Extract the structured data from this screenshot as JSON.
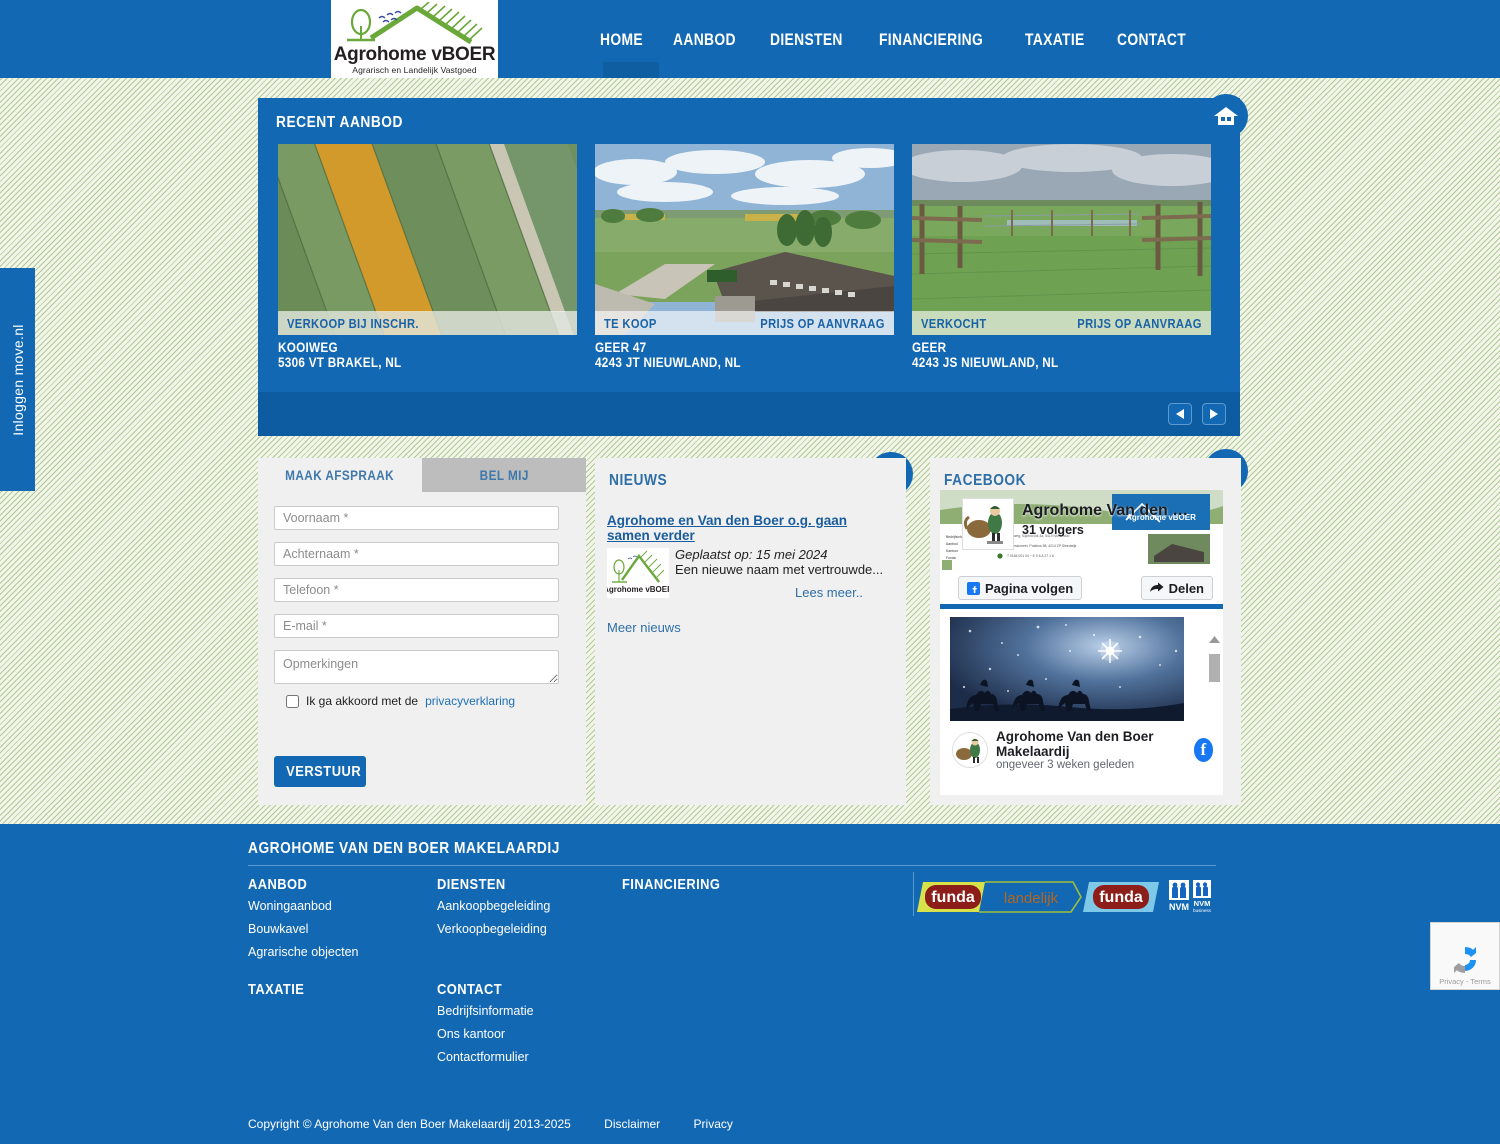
{
  "header": {
    "logo": {
      "name_primary": "Agrohome ",
      "name_secondary": "vBOER",
      "tagline": "Agrarisch en Landelijk Vastgoed"
    },
    "nav": [
      {
        "label": "HOME"
      },
      {
        "label": "AANBOD"
      },
      {
        "label": "DIENSTEN"
      },
      {
        "label": "FINANCIERING"
      },
      {
        "label": "TAXATIE"
      },
      {
        "label": "CONTACT"
      }
    ]
  },
  "left_tab": {
    "label": "Inloggen move.nl"
  },
  "carousel": {
    "heading": "RECENT AANBOD",
    "prev_label": "◀",
    "next_label": "▶",
    "items": [
      {
        "status": "VERKOOP BIJ INSCHR.",
        "price": "",
        "street": "KOOIWEG",
        "city": "5306 VT BRAKEL, NL"
      },
      {
        "status": "TE KOOP",
        "price": "PRIJS OP AANVRAAG",
        "street": "GEER 47",
        "city": "4243 JT NIEUWLAND, NL"
      },
      {
        "status": "VERKOCHT",
        "price": "PRIJS OP AANVRAAG",
        "street": "GEER",
        "city": "4243 JS NIEUWLAND, NL"
      }
    ]
  },
  "form": {
    "tab_active": "MAAK AFSPRAAK",
    "tab_inactive": "BEL MIJ",
    "fields": [
      {
        "placeholder": "Voornaam *",
        "value": ""
      },
      {
        "placeholder": "Achternaam *",
        "value": ""
      },
      {
        "placeholder": "Telefoon *",
        "value": ""
      },
      {
        "placeholder": "E-mail *",
        "value": ""
      }
    ],
    "textarea_placeholder": "Opmerkingen",
    "consent_text": "Ik ga akkoord met de ",
    "consent_link": "privacyverklaring",
    "submit_label": "VERSTUUR"
  },
  "news": {
    "heading": "NIEUWS",
    "item_title": "Agrohome en Van den Boer o.g. gaan samen verder",
    "item_date": "Geplaatst op: 15 mei 2024",
    "item_excerpt": "Een nieuwe naam met vertrouwde...",
    "read_more": "Lees meer..",
    "more_news": "Meer nieuws"
  },
  "facebook": {
    "heading": "FACEBOOK",
    "page_name": "Agrohome Van den …",
    "followers": "31 volgers",
    "follow_label": "Pagina volgen",
    "share_label": "Delen",
    "post_author": "Agrohome Van den Boer Makelaardij",
    "post_time": "ongeveer 3 weken geleden"
  },
  "footer": {
    "brand": "AGROHOME VAN DEN BOER MAKELAARDIJ",
    "columns": [
      {
        "title": "AANBOD",
        "links": [
          "Woningaanbod",
          "Bouwkavel",
          "Agrarische objecten"
        ]
      },
      {
        "title": "DIENSTEN",
        "links": [
          "Aankoopbegeleiding",
          "Verkoopbegeleiding"
        ]
      },
      {
        "title": "FINANCIERING",
        "links": []
      },
      {
        "title": "TAXATIE",
        "links": []
      },
      {
        "title": "CONTACT",
        "links": [
          "Bedrijfsinformatie",
          "Ons kantoor",
          "Contactformulier"
        ]
      }
    ],
    "partners": [
      {
        "name": "funda landelijk"
      },
      {
        "name": "funda"
      },
      {
        "name": "NVM"
      },
      {
        "name": "NVM business"
      }
    ],
    "copyright": "Copyright © Agrohome Van den Boer Makelaardij 2013-2025",
    "disclaimer": "Disclaimer",
    "privacy": "Privacy"
  },
  "recaptcha": {
    "text": "Privacy - Terms"
  },
  "colors": {
    "brand_blue": "#1268b3",
    "dark_blue": "#0d5ba0",
    "panel_gray": "#f0f0f0",
    "link_blue": "#2f6fa8",
    "logo_green": "#5aa832"
  }
}
